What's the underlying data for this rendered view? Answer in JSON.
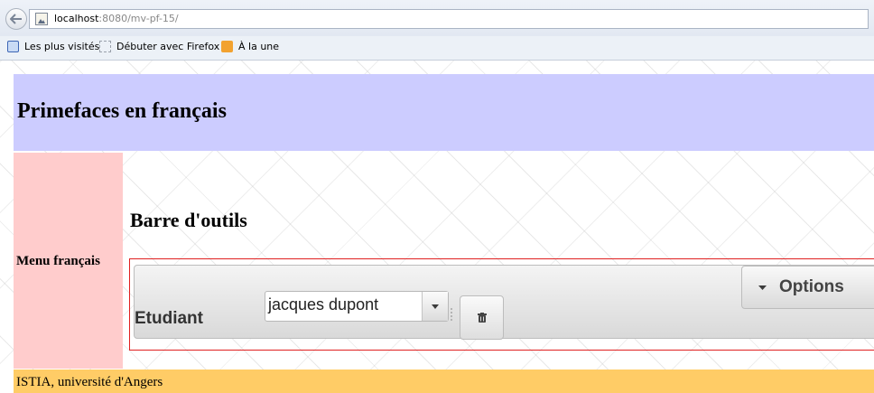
{
  "browser": {
    "url_host": "localhost",
    "url_rest": ":8080/mv-pf-15/",
    "bookmarks": [
      {
        "label": "Les plus visités",
        "icon": "visited-icon"
      },
      {
        "label": "Débuter avec Firefox",
        "icon": "page-icon"
      },
      {
        "label": "À la une",
        "icon": "rss-icon"
      }
    ]
  },
  "page": {
    "header_title": "Primefaces en français",
    "menu_label": "Menu français",
    "section_title": "Barre d'outils",
    "footer_text": "ISTIA, université d'Angers"
  },
  "toolbar": {
    "label": "Etudiant",
    "select_value": "jacques dupont",
    "options_label": "Options",
    "delete_icon": "trash-icon"
  },
  "colors": {
    "header_bg": "#ccccff",
    "menu_bg": "#ffcccc",
    "footer_bg": "#ffcc66",
    "toolbar_border": "#e02020"
  }
}
